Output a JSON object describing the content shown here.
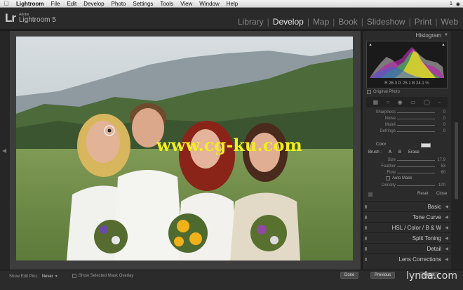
{
  "menubar": {
    "app": "Lightroom",
    "items": [
      "File",
      "Edit",
      "Develop",
      "Photo",
      "Settings",
      "Tools",
      "View",
      "Window",
      "Help"
    ],
    "status_count": "1"
  },
  "app": {
    "logo_mark": "Lr",
    "brand_small": "Adobe",
    "brand_name": "Lightroom 5"
  },
  "modules": [
    {
      "label": "Library",
      "active": false
    },
    {
      "label": "Develop",
      "active": true
    },
    {
      "label": "Map",
      "active": false
    },
    {
      "label": "Book",
      "active": false
    },
    {
      "label": "Slideshow",
      "active": false
    },
    {
      "label": "Print",
      "active": false
    },
    {
      "label": "Web",
      "active": false
    }
  ],
  "histogram": {
    "title": "Histogram",
    "r_label": "R",
    "r_value": "26.3",
    "g_label": "G",
    "g_value": "25.1",
    "b_label": "B",
    "b_value": "24.1",
    "unit": "%",
    "original_photo": "Original Photo"
  },
  "adjust": [
    {
      "label": "Sharpness",
      "value": "0"
    },
    {
      "label": "Noise",
      "value": "0"
    },
    {
      "label": "Moiré",
      "value": "0"
    },
    {
      "label": "Defringe",
      "value": "0"
    }
  ],
  "color_label": "Color",
  "brush": {
    "label": "Brush :",
    "a": "A",
    "b": "B",
    "erase": "Erase",
    "sliders": [
      {
        "label": "Size",
        "value": "17.9"
      },
      {
        "label": "Feather",
        "value": "53"
      },
      {
        "label": "Flow",
        "value": "60"
      }
    ],
    "auto_mask": "Auto Mask",
    "density_label": "Density",
    "density_value": "100",
    "reset": "Reset",
    "close": "Close"
  },
  "sections": [
    {
      "label": "Basic"
    },
    {
      "label": "Tone Curve"
    },
    {
      "label": "HSL / Color / B & W"
    },
    {
      "label": "Split Toning"
    },
    {
      "label": "Detail"
    },
    {
      "label": "Lens Corrections"
    }
  ],
  "bottom": {
    "show_edit_pins_label": "Show Edit Pins :",
    "show_edit_pins_value": "Never",
    "show_mask_overlay": "Show Selected Mask Overlay",
    "done": "Done",
    "previous": "Previous",
    "reset": "Reset"
  },
  "watermark": "www.cg-ku.com",
  "lynda": "lynda.com",
  "colors": {
    "background": "#1c1c1c",
    "panel": "#2b2b2b",
    "watermark": "#f2ee1e",
    "active_module": "#e8e8e8"
  }
}
